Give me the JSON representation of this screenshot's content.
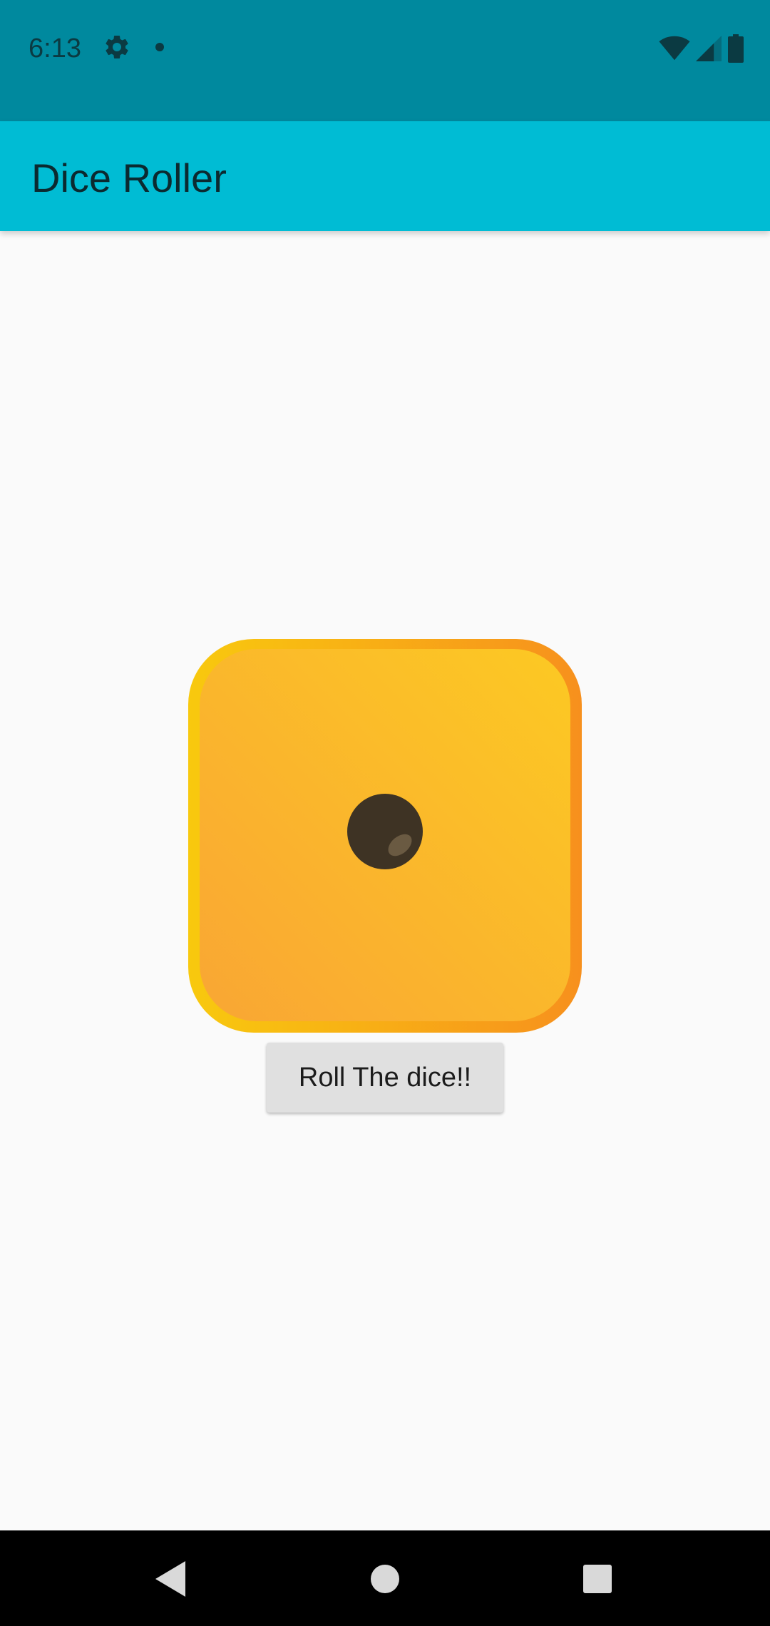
{
  "status_bar": {
    "time": "6:13",
    "icons": [
      "gear-icon",
      "notification-dot-icon",
      "wifi-icon",
      "signal-icon",
      "battery-icon"
    ],
    "background": "#00899e"
  },
  "app_bar": {
    "title": "Dice Roller",
    "background": "#00bcd4"
  },
  "main": {
    "dice": {
      "value": 1,
      "icon": "dice-one-icon",
      "colors": {
        "face": "#f9b82c",
        "border": "#f7941d",
        "pip": "#3e3324"
      }
    },
    "roll_button": {
      "label": "Roll The dice!!"
    }
  },
  "nav_bar": {
    "buttons": [
      "back-icon",
      "home-icon",
      "recents-icon"
    ]
  }
}
